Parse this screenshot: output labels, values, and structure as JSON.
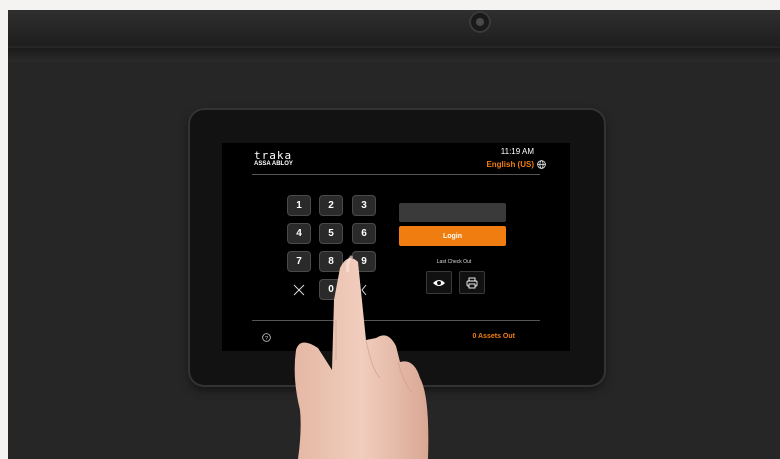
{
  "header": {
    "logo_text": "traka",
    "logo_subtext": "ASSA ABLOY",
    "time": "11:19 AM",
    "language": "English (US)",
    "globe_icon": "globe-icon"
  },
  "keypad": {
    "keys": [
      "1",
      "2",
      "3",
      "4",
      "5",
      "6",
      "7",
      "8",
      "9",
      "0"
    ],
    "clear_icon": "close-icon",
    "backspace_icon": "chevron-left-icon"
  },
  "login": {
    "pin_value": "",
    "button_label": "Login"
  },
  "last_checkout": {
    "label": "Last Check Out",
    "view_icon": "eye-icon",
    "print_icon": "printer-icon"
  },
  "footer": {
    "help_icon": "help-icon",
    "assets_out": "0 Assets Out"
  },
  "colors": {
    "accent": "#f07d10",
    "screen_bg": "#000000",
    "key_bg": "#2a2a2a"
  }
}
